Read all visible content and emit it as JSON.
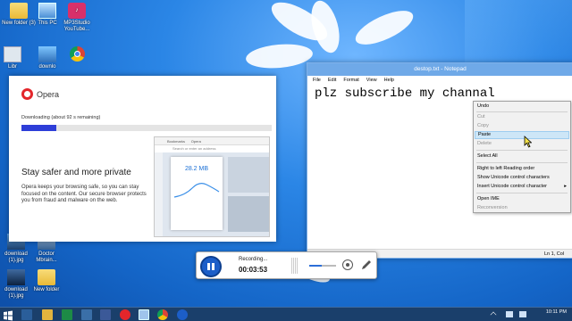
{
  "desktop": {
    "icons": [
      {
        "label": "New folder (3)",
        "icon": "folder-icon"
      },
      {
        "label": "This PC",
        "icon": "computer-icon"
      },
      {
        "label": "MP3Studio YouTube...",
        "icon": "mp3studio-icon"
      },
      {
        "label": "Libr",
        "icon": "library-icon"
      },
      {
        "label": "downlo",
        "icon": "download-icon"
      },
      {
        "label": "",
        "icon": "chrome-icon"
      },
      {
        "label": "download (1).jpg",
        "icon": "image-file-icon"
      },
      {
        "label": "Doctor Mbrain...",
        "icon": "image-file-icon"
      },
      {
        "label": "download (1).jpg",
        "icon": "image-file-icon"
      },
      {
        "label": "New folder",
        "icon": "folder-icon"
      }
    ]
  },
  "opera": {
    "brand": "Opera",
    "download_status": "Downloading (about 92 s remaining)",
    "progress_fraction": 0.14,
    "headline": "Stay safer and more private",
    "description": "Opera keeps your browsing safe, so you can stay focused on the content. Our secure browser protects you from fraud and malware on the web.",
    "preview": {
      "tab1": "Bookmarks",
      "tab2": "Opera",
      "search_placeholder": "Search or enter an address",
      "stat_value": "28.2 MB"
    }
  },
  "notepad": {
    "title": "destop.txt - Notepad",
    "menu": [
      "File",
      "Edit",
      "Format",
      "View",
      "Help"
    ],
    "content": "plz subscribe my channal",
    "status": "Ln 1, Col"
  },
  "context_menu": {
    "items": [
      {
        "label": "Undo",
        "disabled": false
      },
      {
        "label": "Cut",
        "disabled": true
      },
      {
        "label": "Copy",
        "disabled": true
      },
      {
        "label": "Paste",
        "disabled": false,
        "highlighted": true
      },
      {
        "label": "Delete",
        "disabled": true
      },
      {
        "label": "Select All",
        "disabled": false
      },
      {
        "label": "Right to left Reading order",
        "disabled": false
      },
      {
        "label": "Show Unicode control characters",
        "disabled": false
      },
      {
        "label": "Insert Unicode control character",
        "disabled": false,
        "submenu": true
      },
      {
        "label": "Open IME",
        "disabled": false
      },
      {
        "label": "Reconversion",
        "disabled": true
      }
    ]
  },
  "recorder": {
    "status": "Recording...",
    "elapsed": "00:03:53",
    "volume_fraction": 0.45
  },
  "taskbar": {
    "time": "10:11 PM",
    "date": ""
  },
  "colors": {
    "opera_red": "#e3262b",
    "progress_blue": "#2e3ed8",
    "recorder_blue": "#1c5ec8",
    "taskbar": "#1a3f6b"
  }
}
